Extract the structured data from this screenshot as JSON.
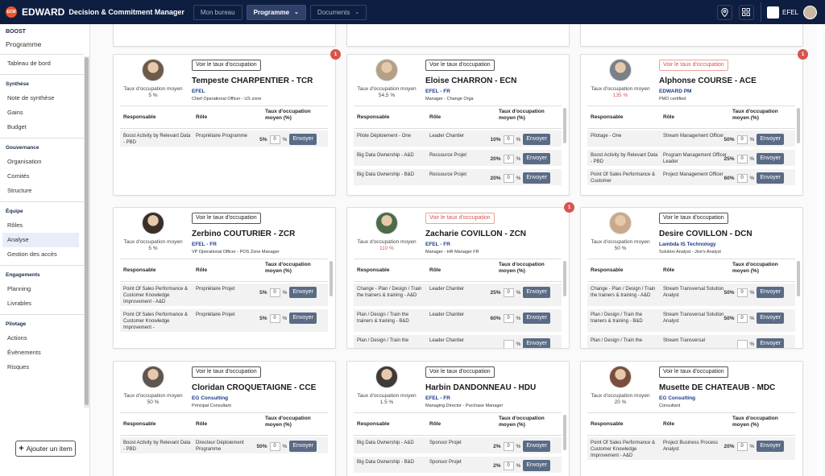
{
  "topbar": {
    "logo_text": "ECM",
    "brand": "EDWARD",
    "subtitle": "Decision & Commitment Manager",
    "tabs": [
      {
        "label": "Mon bureau",
        "active": false,
        "has_dropdown": false
      },
      {
        "label": "Programme",
        "active": true,
        "has_dropdown": true
      },
      {
        "label": "Documents",
        "active": false,
        "has_dropdown": true
      }
    ],
    "icons": [
      "location-icon",
      "grid-icon"
    ],
    "user": "EFEL"
  },
  "sidebar": {
    "org": "BOOST",
    "title": "Programme",
    "sections": [
      {
        "title": "",
        "items": [
          {
            "label": "Tableau de bord",
            "active": false
          }
        ]
      },
      {
        "title": "Synthèse",
        "items": [
          {
            "label": "Note de synthèse",
            "active": false
          },
          {
            "label": "Gains",
            "active": false
          },
          {
            "label": "Budget",
            "active": false
          }
        ]
      },
      {
        "title": "Gouvernance",
        "items": [
          {
            "label": "Organisation",
            "active": false
          },
          {
            "label": "Comités",
            "active": false
          },
          {
            "label": "Structure",
            "active": false
          }
        ]
      },
      {
        "title": "Équipe",
        "items": [
          {
            "label": "Rôles",
            "active": false
          },
          {
            "label": "Analyse",
            "active": true
          },
          {
            "label": "Gestion des accès",
            "active": false
          }
        ]
      },
      {
        "title": "Engagements",
        "items": [
          {
            "label": "Planning",
            "active": false
          },
          {
            "label": "Livrables",
            "active": false
          }
        ]
      },
      {
        "title": "Pilotage",
        "items": [
          {
            "label": "Actions",
            "active": false
          },
          {
            "label": "Évènements",
            "active": false
          },
          {
            "label": "Risques",
            "active": false
          }
        ]
      }
    ],
    "add_button": "Ajouter un item"
  },
  "labels": {
    "avg_rate_line1": "Taux d'occupation moyen",
    "taux_button": "Voir le taux d'occupation",
    "col_resp": "Responsable",
    "col_role": "Rôle",
    "col_rate_l1": "Taux d'occupation",
    "col_rate_l2": "moyen (%)",
    "send": "Envoyer",
    "percent": "%"
  },
  "colors": {
    "topbar": "#0e1e40",
    "accent_red": "#d9534f",
    "org_blue": "#1b3c8c",
    "send_button": "#5a6b86"
  },
  "cards": [
    {
      "name": "Tempeste CHARPENTIER - TCR",
      "org": "EFEL",
      "position": "Chief Operational Officer - US zone",
      "avg": "5 %",
      "avg_alert": false,
      "badge": "1",
      "rows": [
        {
          "resp": "Boost Activity by Relevant Data - PBD",
          "role": "Propriétaire Programme",
          "pct": "5%",
          "input": "0"
        }
      ]
    },
    {
      "name": "Eloise CHARRON - ECN",
      "org": "EFEL - FR",
      "position": "Manager - Change Orga",
      "avg": "54,5 %",
      "avg_alert": false,
      "badge": "",
      "rows": [
        {
          "resp": "Pilote Déploiement - One",
          "role": "Leader Chantier",
          "pct": "10%",
          "input": "0"
        },
        {
          "resp": "Big Data Ownership - A&D",
          "role": "Ressource Projet",
          "pct": "20%",
          "input": "0"
        },
        {
          "resp": "Big Data Ownership - B&D",
          "role": "Ressource Projet",
          "pct": "20%",
          "input": "0"
        }
      ]
    },
    {
      "name": "Alphonse COURSE - ACE",
      "org": "EDWARD PM",
      "position": "PMO certified",
      "avg": "135 %",
      "avg_alert": true,
      "badge": "1",
      "rows": [
        {
          "resp": "Pilotage - One",
          "role": "Stream Management Officer",
          "pct": "50%",
          "input": "0"
        },
        {
          "resp": "Boost Activity by Relevant Data - PBD",
          "role": "Program Management Officer Leader",
          "pct": "25%",
          "input": "0"
        },
        {
          "resp": "Point Of Sales Performance & Customer",
          "role": "Project Management Officer",
          "pct": "60%",
          "input": "0"
        }
      ]
    },
    {
      "name": "Zerbino COUTURIER - ZCR",
      "org": "EFEL - FR",
      "position": "VP Operational Officer - POS Zone Manager",
      "avg": "5 %",
      "avg_alert": false,
      "badge": "",
      "rows": [
        {
          "resp": "Point Of Sales Performance & Customer Knowledge Improvement - A&D",
          "role": "Propriétaire Projet",
          "pct": "5%",
          "input": "0"
        },
        {
          "resp": "Point Of Sales Performance & Customer Knowledge Improvement -",
          "role": "Propriétaire Projet",
          "pct": "5%",
          "input": "0"
        }
      ]
    },
    {
      "name": "Zacharie COVILLON - ZCN",
      "org": "EFEL - FR",
      "position": "Manager - HR Manager FR",
      "avg": "110 %",
      "avg_alert": true,
      "badge": "1",
      "rows": [
        {
          "resp": "Change - Plan / Design / Train the trainers & training - A&D",
          "role": "Leader Chantier",
          "pct": "25%",
          "input": "0"
        },
        {
          "resp": "Plan / Design / Train the trainers & training - B&D",
          "role": "Leader Chantier",
          "pct": "60%",
          "input": "0"
        },
        {
          "resp": "Plan / Design / Train the",
          "role": "Leader Chantier",
          "pct": "",
          "input": ""
        }
      ]
    },
    {
      "name": "Desire COVILLON - DCN",
      "org": "Lambda IS Technology",
      "position": "Solution Analyst - Jive's Analyst",
      "avg": "50 %",
      "avg_alert": false,
      "badge": "",
      "rows": [
        {
          "resp": "Change - Plan / Design / Train the trainers & training - A&D",
          "role": "Stream Transversal Solution Analyst",
          "pct": "50%",
          "input": "0"
        },
        {
          "resp": "Plan / Design / Train the trainers & training - B&D",
          "role": "Stream Transversal Solution Analyst",
          "pct": "50%",
          "input": "0"
        },
        {
          "resp": "Plan / Design / Train the",
          "role": "Stream Transversal",
          "pct": "",
          "input": ""
        }
      ]
    },
    {
      "name": "Cloridan CROQUETAIGNE - CCE",
      "org": "EG Consulting",
      "position": "Principal Consultant",
      "avg": "50 %",
      "avg_alert": false,
      "badge": "",
      "rows": [
        {
          "resp": "Boost Activity by Relevant Data - PBD",
          "role": "Directeur Déploiement Programme",
          "pct": "50%",
          "input": "0"
        }
      ]
    },
    {
      "name": "Harbin DANDONNEAU - HDU",
      "org": "EFEL - FR",
      "position": "Managing Director - Purchase Manager",
      "avg": "1.5 %",
      "avg_alert": false,
      "badge": "",
      "rows": [
        {
          "resp": "Big Data Ownership - A&D",
          "role": "Sponsor Projet",
          "pct": "2%",
          "input": "0"
        },
        {
          "resp": "Big Data Ownership - B&D",
          "role": "Sponsor Projet",
          "pct": "2%",
          "input": "0"
        }
      ]
    },
    {
      "name": "Musette DE CHATEAUB - MDC",
      "org": "EG Consulting",
      "position": "Consultant",
      "avg": "20 %",
      "avg_alert": false,
      "badge": "",
      "rows": [
        {
          "resp": "Point Of Sales Performance & Customer Knowledge Improvement - A&D",
          "role": "Project Business Process Analyst",
          "pct": "20%",
          "input": "0"
        }
      ]
    }
  ]
}
